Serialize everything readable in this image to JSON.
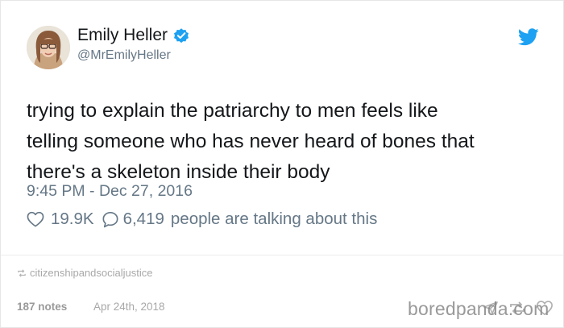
{
  "tweet": {
    "display_name": "Emily Heller",
    "handle": "@MrEmilyHeller",
    "text_lines": [
      "trying to explain the patriarchy to men feels like",
      "telling someone who has never heard of bones that",
      "there's a skeleton inside their body"
    ],
    "timestamp": "9:45 PM - Dec 27, 2016",
    "likes": "19.9K",
    "comments": "6,419",
    "comments_suffix": "people are talking about this",
    "colors": {
      "verified": "#1da1f2",
      "twitter_bird": "#1da1f2",
      "text": "#14171a",
      "muted": "#657786"
    }
  },
  "post": {
    "source": "citizenshipandsocialjustice",
    "notes": "187 notes",
    "date": "Apr 24th, 2018"
  },
  "watermark": "boredpanda.com",
  "icons": [
    "verified-badge-icon",
    "twitter-bird-icon",
    "heart-icon",
    "comment-bubble-icon",
    "reblog-icon",
    "share-icon",
    "like-heart-icon"
  ]
}
